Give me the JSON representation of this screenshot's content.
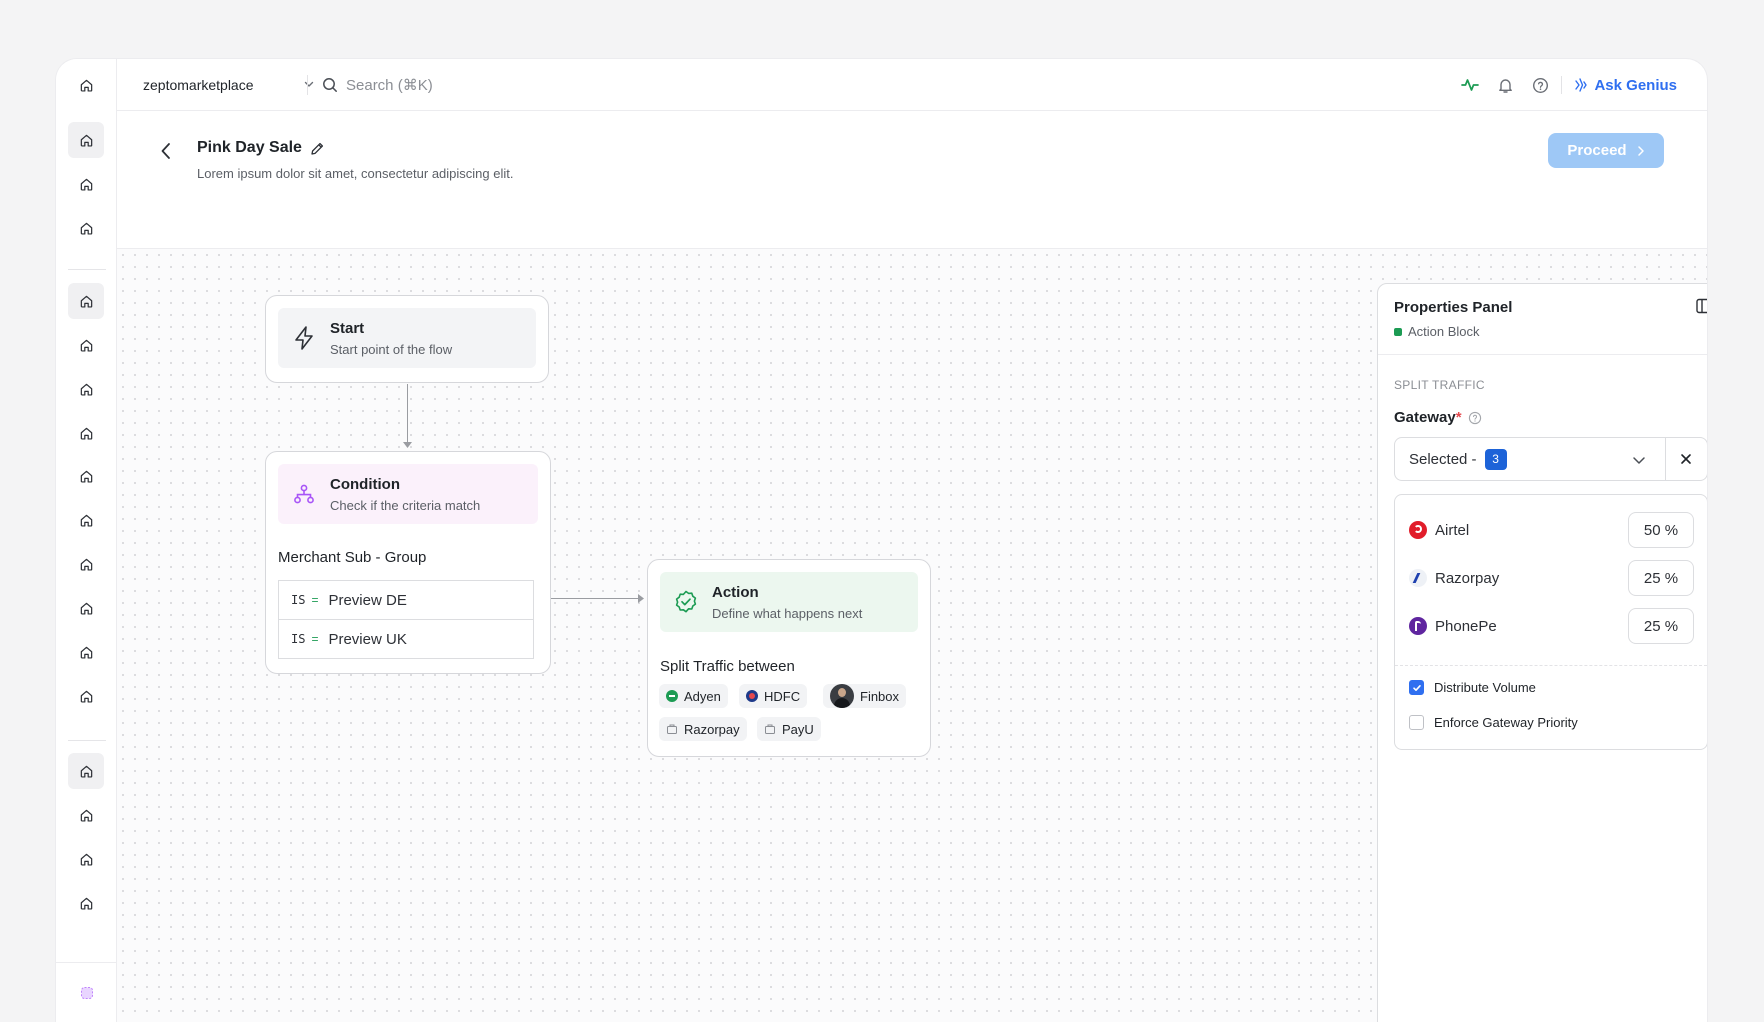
{
  "topbar": {
    "workspace": "zeptomarketplace",
    "search_placeholder": "Search  (⌘K)",
    "ask_genius": "Ask Genius"
  },
  "page": {
    "title": "Pink Day Sale",
    "subtitle": "Lorem ipsum dolor sit amet, consectetur adipiscing elit.",
    "proceed": "Proceed"
  },
  "nodes": {
    "start": {
      "title": "Start",
      "subtitle": "Start point of the flow"
    },
    "condition": {
      "title": "Condition",
      "subtitle": "Check if the criteria match",
      "field": "Merchant Sub - Group",
      "rows": [
        {
          "op": "IS",
          "eq": "=",
          "value": "Preview DE"
        },
        {
          "op": "IS",
          "eq": "=",
          "value": "Preview UK"
        }
      ]
    },
    "action": {
      "title": "Action",
      "subtitle": "Define what happens next",
      "split_label": "Split Traffic between",
      "chips": [
        "Adyen",
        "HDFC",
        "Finbox",
        "Razorpay",
        "PayU"
      ]
    }
  },
  "panel": {
    "title": "Properties Panel",
    "block": "Action Block",
    "section": "SPLIT TRAFFIC",
    "gateway_label": "Gateway",
    "required_mark": "*",
    "selected_label": "Selected -",
    "selected_count": "3",
    "gateways": [
      {
        "name": "Airtel",
        "percent": "50 %"
      },
      {
        "name": "Razorpay",
        "percent": "25 %"
      },
      {
        "name": "PhonePe",
        "percent": "25 %"
      }
    ],
    "distribute_volume": "Distribute Volume",
    "distribute_volume_checked": true,
    "enforce_priority": "Enforce Gateway Priority",
    "enforce_priority_checked": false
  },
  "colors": {
    "accent": "#2f6ff0",
    "proceed_bg": "#9ec8f6",
    "condition_bg": "#fbf1fb",
    "action_bg": "#ecf7ef",
    "start_bg": "#f3f4f6",
    "status_green": "#1c9b53",
    "required_red": "#e5484d"
  },
  "icons": {
    "sidebar": "home-icon",
    "start": "bolt-icon",
    "condition": "branch-icon",
    "action": "verified-badge-icon"
  }
}
